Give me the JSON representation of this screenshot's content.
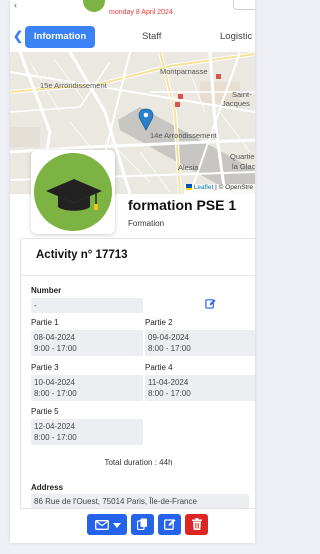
{
  "header": {
    "date": "monday 8 April 2024"
  },
  "tabs": {
    "information": "Information",
    "staff": "Staff",
    "logistics": "Logistic"
  },
  "map": {
    "labels": {
      "montparnasse": "Montparnasse",
      "arr15": "15e Arrondissement",
      "saint_jacques_1": "Saint-",
      "saint_jacques_2": "Jacques",
      "arr14": "14e Arrondissement",
      "alesia": "Alesia",
      "quartier_1": "Quartier",
      "quartier_2": "la Glac"
    },
    "attribution_leaflet": "Leaflet",
    "attribution_rest": " | © OpenStre"
  },
  "profile": {
    "title": "formation PSE 1",
    "subtitle": "Formation"
  },
  "activity": {
    "title": "Activity n° 17713",
    "number_label": "Number",
    "number_value": "-",
    "parts": [
      {
        "label": "Partie 1",
        "date": "08-04-2024",
        "time": "9:00 - 17:00"
      },
      {
        "label": "Partie 2",
        "date": "09-04-2024",
        "time": "8:00 - 17:00"
      },
      {
        "label": "Partie 3",
        "date": "10-04-2024",
        "time": "8:00 - 17:00"
      },
      {
        "label": "Partie 4",
        "date": "11-04-2024",
        "time": "8:00 - 17:00"
      },
      {
        "label": "Partie 5",
        "date": "12-04-2024",
        "time": "8:00 - 17:00"
      }
    ],
    "total": "Total duration : 44h",
    "address_label": "Address",
    "address_value": "86 Rue de l'Ouest, 75014 Paris, Île-de-France"
  },
  "colors": {
    "accent": "#3b82f6",
    "button_blue": "#2563eb",
    "button_red": "#dc2626",
    "avatar_green": "#7cb342",
    "date_red": "#e53935"
  },
  "icons": {
    "mail": "envelope-icon",
    "dropdown": "caret-down-icon",
    "copy": "copy-icon",
    "edit": "edit-icon",
    "delete": "trash-icon",
    "marker": "map-marker-icon",
    "cap": "graduation-cap-icon"
  }
}
